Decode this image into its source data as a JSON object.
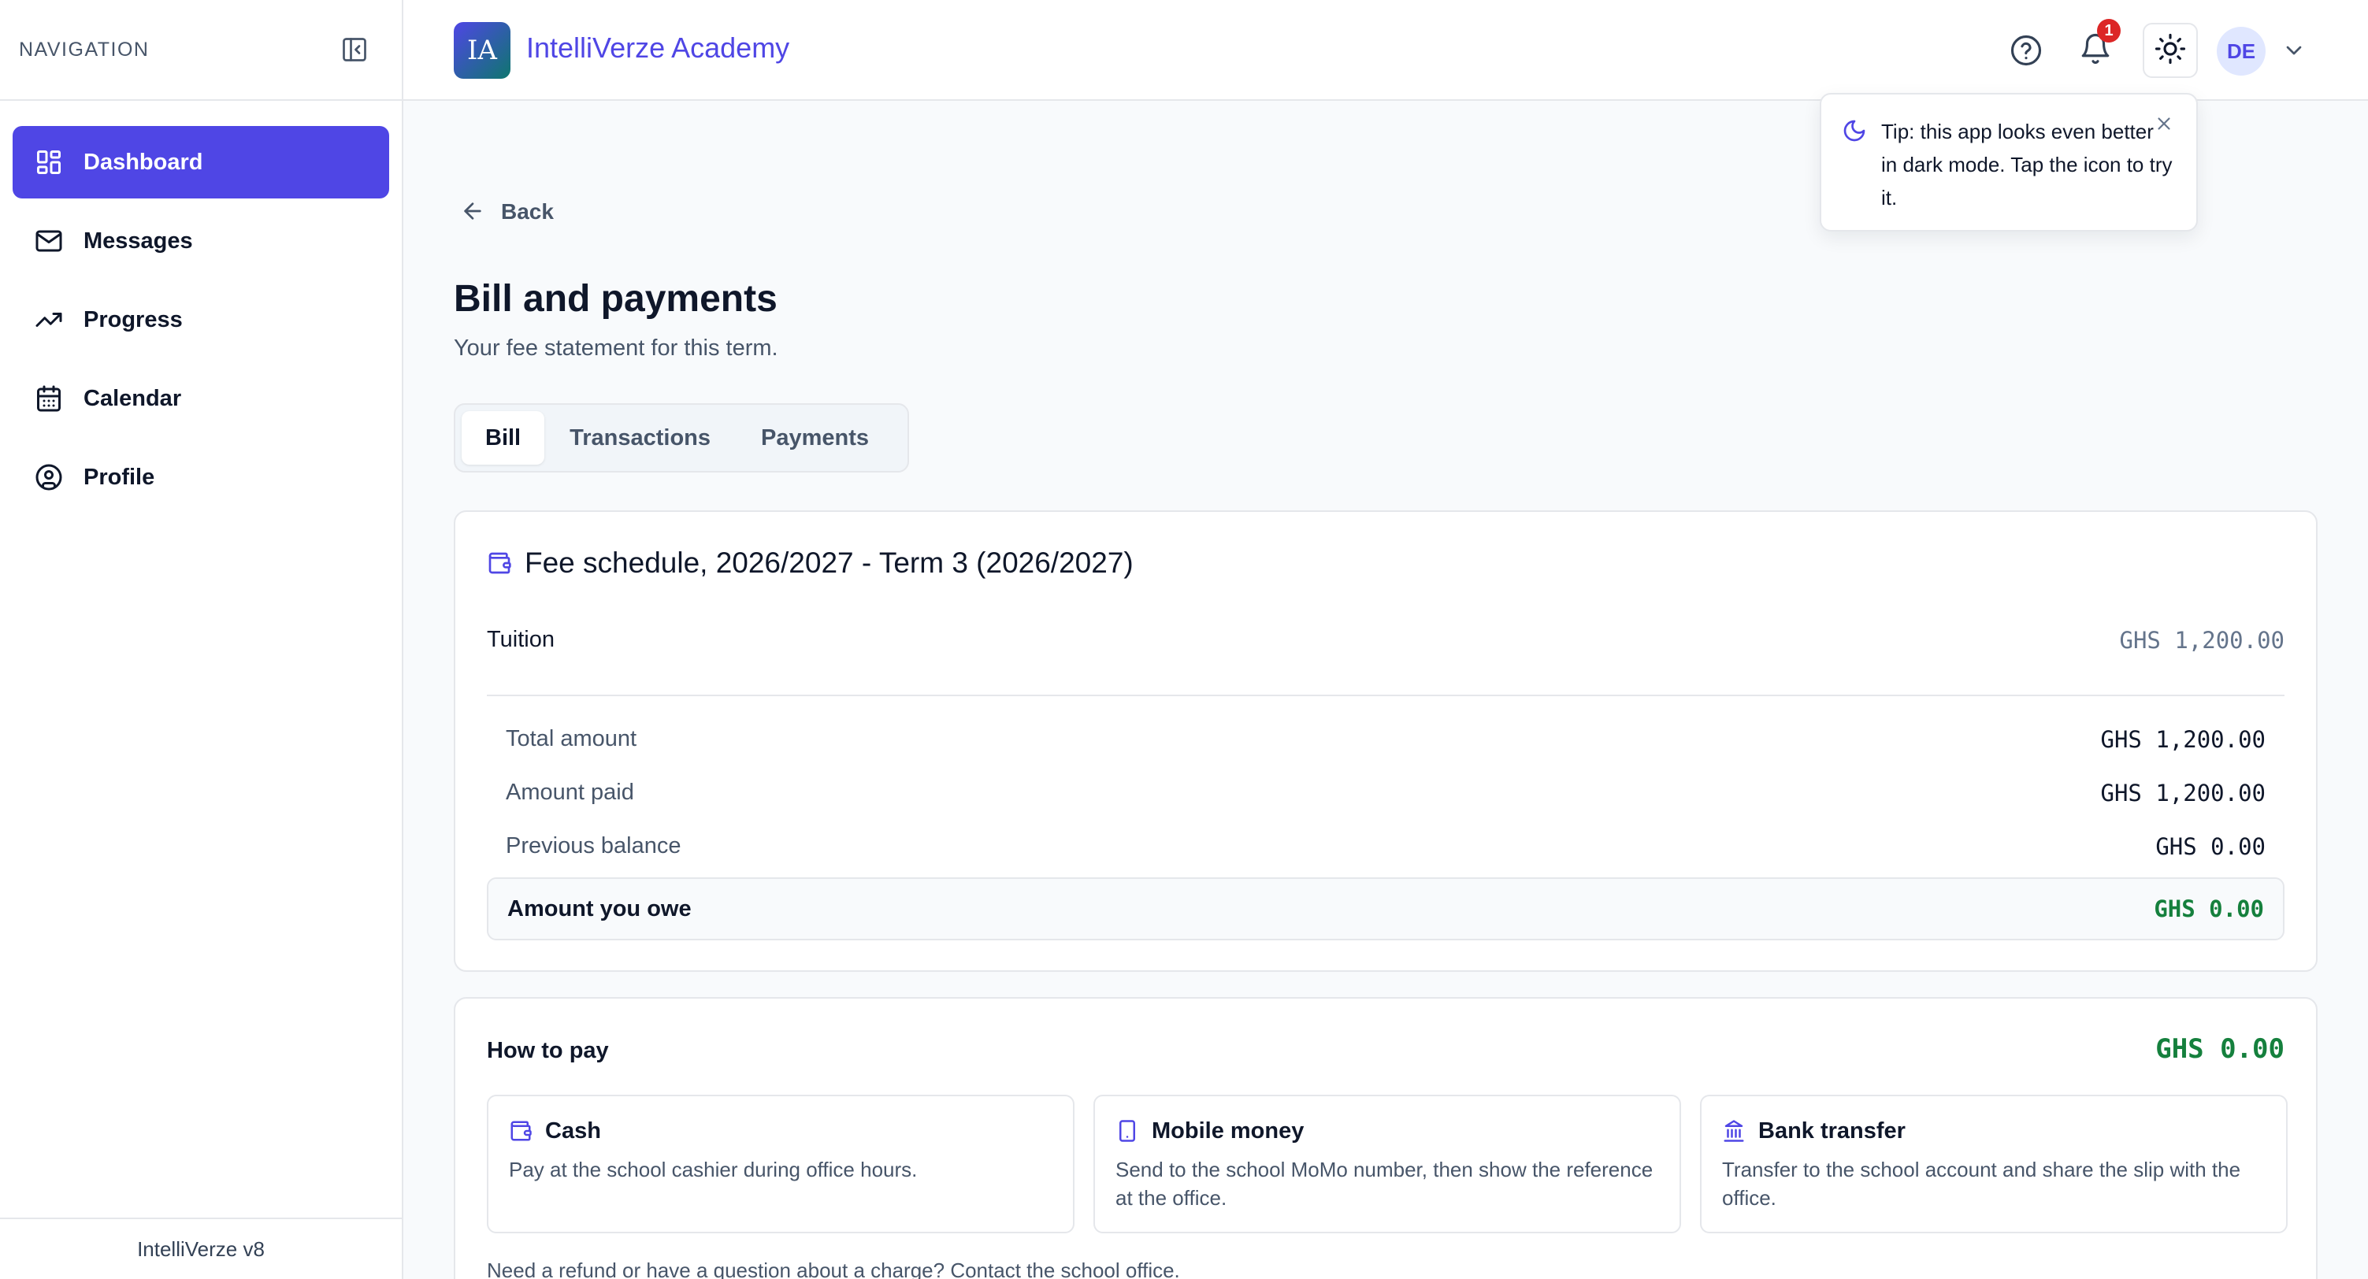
{
  "sidebar": {
    "title": "NAVIGATION",
    "items": [
      {
        "label": "Dashboard",
        "icon": "dashboard-icon"
      },
      {
        "label": "Messages",
        "icon": "mail-icon"
      },
      {
        "label": "Progress",
        "icon": "trending-up-icon"
      },
      {
        "label": "Calendar",
        "icon": "calendar-icon"
      },
      {
        "label": "Profile",
        "icon": "user-circle-icon"
      }
    ],
    "footer": "IntelliVerze v8"
  },
  "header": {
    "logo_text": "IA",
    "brand": "IntelliVerze Academy",
    "notification_count": "1",
    "avatar_initials": "DE"
  },
  "tip": {
    "text": "Tip: this app looks even better in dark mode. Tap the icon to try it."
  },
  "main": {
    "back_label": "Back",
    "title": "Bill and payments",
    "subtitle": "Your fee statement for this term.",
    "tabs": [
      {
        "label": "Bill"
      },
      {
        "label": "Transactions"
      },
      {
        "label": "Payments"
      }
    ]
  },
  "fee": {
    "title": "Fee schedule, 2026/2027 - Term 3 (2026/2027)",
    "tuition_label": "Tuition",
    "tuition_value": "GHS 1,200.00",
    "total_label": "Total amount",
    "total_value": "GHS 1,200.00",
    "paid_label": "Amount paid",
    "paid_value": "GHS 1,200.00",
    "prev_label": "Previous balance",
    "prev_value": "GHS 0.00",
    "owe_label": "Amount you owe",
    "owe_value": "GHS 0.00"
  },
  "howto": {
    "title": "How to pay",
    "amount": "GHS 0.00",
    "methods": [
      {
        "title": "Cash",
        "desc": "Pay at the school cashier during office hours."
      },
      {
        "title": "Mobile money",
        "desc": "Send to the school MoMo number, then show the reference at the office."
      },
      {
        "title": "Bank transfer",
        "desc": "Transfer to the school account and share the slip with the office."
      }
    ],
    "note": "Need a refund or have a question about a charge? Contact the school office."
  },
  "colors": {
    "accent": "#4f46e5",
    "success": "#15803d",
    "danger": "#dc2626"
  }
}
